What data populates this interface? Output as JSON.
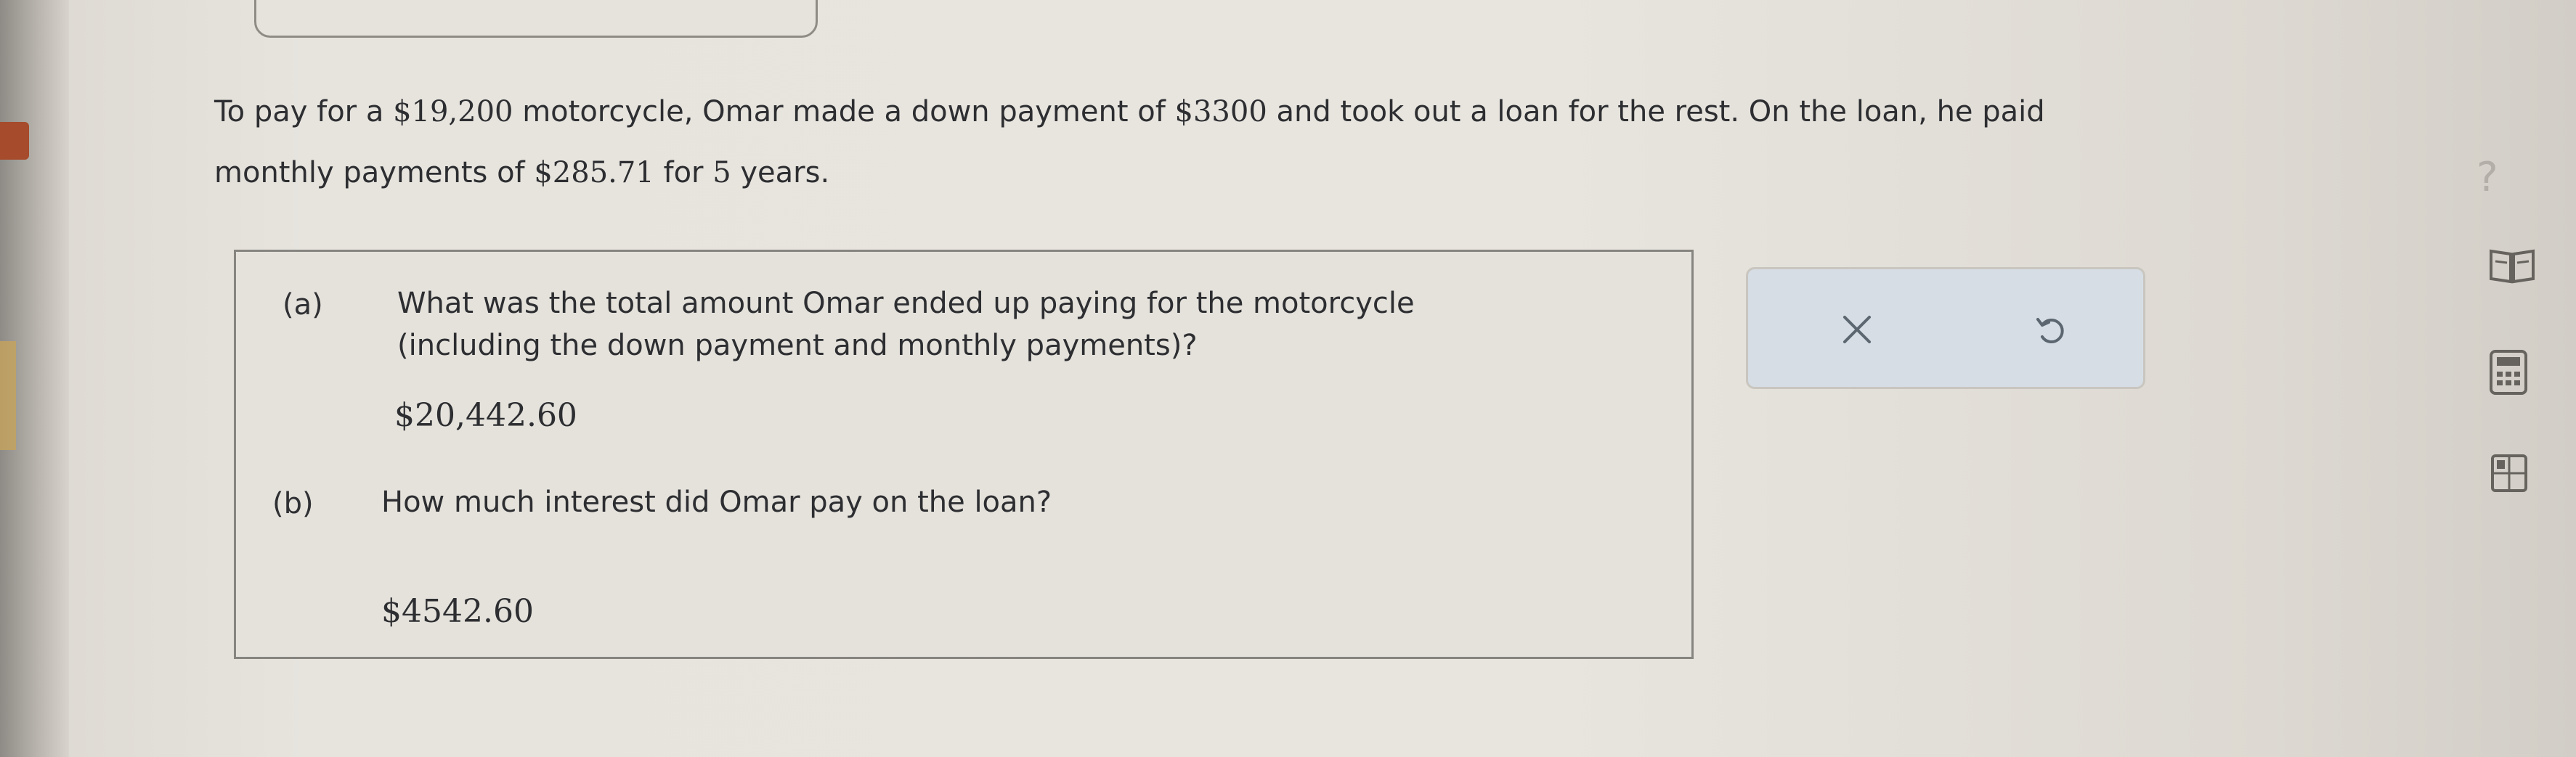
{
  "problem": {
    "line1": {
      "seg1": "To pay for a ",
      "price": "$19,200",
      "seg2": " motorcycle, Omar made a down payment of ",
      "down_payment": "$3300",
      "seg3": " and took out a loan for the rest. On the loan, he paid"
    },
    "line2": {
      "seg1": "monthly payments of ",
      "monthly_payment": "$285.71",
      "seg2": " for ",
      "years": "5",
      "seg3": " years."
    }
  },
  "parts": [
    {
      "label": "(a)",
      "question_line1": "What was the total amount Omar ended up paying for the motorcycle",
      "question_line2": "(including the down payment and monthly payments)?",
      "answer": "$20,442.60"
    },
    {
      "label": "(b)",
      "question_line1": "How much interest did Omar pay on the loan?",
      "answer": "$4542.60"
    }
  ],
  "toolbar": {
    "clear_icon": "x-icon",
    "undo_icon": "undo-icon"
  },
  "sidebar_icons": [
    "help-icon",
    "book-icon",
    "calculator-icon",
    "grid-icon"
  ],
  "help": {
    "label": "?"
  },
  "colors": {
    "page": "#e8e5df",
    "box_border": "#868580",
    "toolbar_bg": "#d6dde4",
    "text": "#2d2e31"
  }
}
